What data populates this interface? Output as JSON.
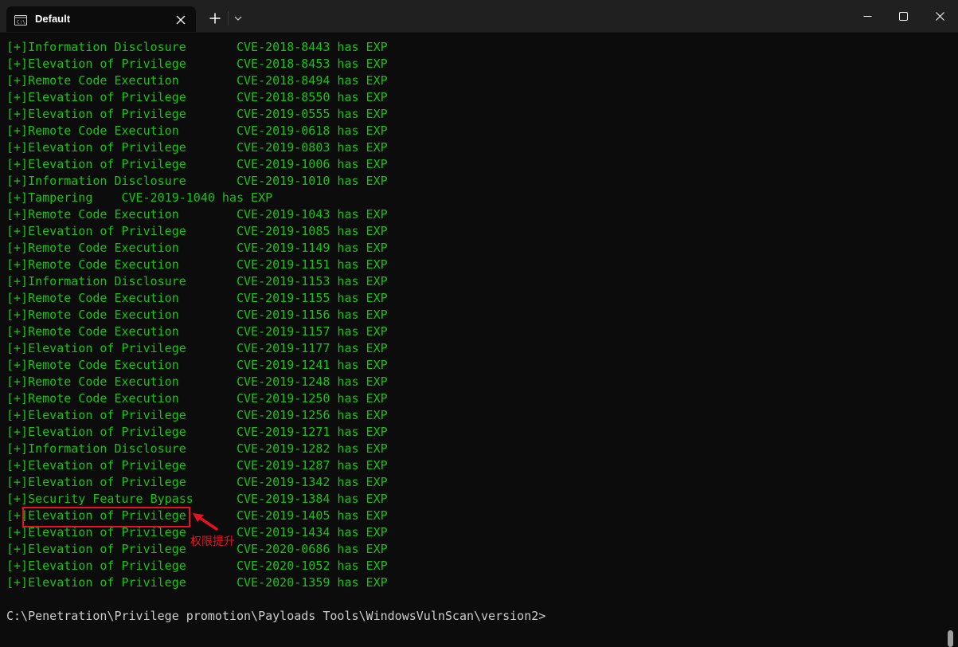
{
  "window": {
    "tab_title": "Default",
    "tab_icon": "terminal-icon",
    "close_tab_icon": "close-icon",
    "new_tab_icon": "plus-icon",
    "dropdown_icon": "chevron-down-icon",
    "minimize_icon": "minimize-icon",
    "maximize_icon": "maximize-icon",
    "close_window_icon": "close-icon"
  },
  "colors": {
    "output_green": "#16c60c",
    "prompt_gray": "#cccccc",
    "annotation_red": "#e81123",
    "terminal_bg": "#0c0c0c",
    "titlebar_bg": "#202020"
  },
  "terminal": {
    "lines": [
      "[+]Information Disclosure       CVE-2018-8443 has EXP",
      "[+]Elevation of Privilege       CVE-2018-8453 has EXP",
      "[+]Remote Code Execution        CVE-2018-8494 has EXP",
      "[+]Elevation of Privilege       CVE-2018-8550 has EXP",
      "[+]Elevation of Privilege       CVE-2019-0555 has EXP",
      "[+]Remote Code Execution        CVE-2019-0618 has EXP",
      "[+]Elevation of Privilege       CVE-2019-0803 has EXP",
      "[+]Elevation of Privilege       CVE-2019-1006 has EXP",
      "[+]Information Disclosure       CVE-2019-1010 has EXP",
      "[+]Tampering    CVE-2019-1040 has EXP",
      "[+]Remote Code Execution        CVE-2019-1043 has EXP",
      "[+]Elevation of Privilege       CVE-2019-1085 has EXP",
      "[+]Remote Code Execution        CVE-2019-1149 has EXP",
      "[+]Remote Code Execution        CVE-2019-1151 has EXP",
      "[+]Information Disclosure       CVE-2019-1153 has EXP",
      "[+]Remote Code Execution        CVE-2019-1155 has EXP",
      "[+]Remote Code Execution        CVE-2019-1156 has EXP",
      "[+]Remote Code Execution        CVE-2019-1157 has EXP",
      "[+]Elevation of Privilege       CVE-2019-1177 has EXP",
      "[+]Remote Code Execution        CVE-2019-1241 has EXP",
      "[+]Remote Code Execution        CVE-2019-1248 has EXP",
      "[+]Remote Code Execution        CVE-2019-1250 has EXP",
      "[+]Elevation of Privilege       CVE-2019-1256 has EXP",
      "[+]Elevation of Privilege       CVE-2019-1271 has EXP",
      "[+]Information Disclosure       CVE-2019-1282 has EXP",
      "[+]Elevation of Privilege       CVE-2019-1287 has EXP",
      "[+]Elevation of Privilege       CVE-2019-1342 has EXP",
      "[+]Security Feature Bypass      CVE-2019-1384 has EXP",
      "[+]Elevation of Privilege       CVE-2019-1405 has EXP",
      "[+]Elevation of Privilege       CVE-2019-1434 has EXP",
      "[+]Elevation of Privilege       CVE-2020-0686 has EXP",
      "[+]Elevation of Privilege       CVE-2020-1052 has EXP",
      "[+]Elevation of Privilege       CVE-2020-1359 has EXP"
    ],
    "prompt": "C:\\Penetration\\Privilege promotion\\Payloads Tools\\WindowsVulnScan\\version2>"
  },
  "annotation": {
    "label": "权限提升",
    "arrow_icon": "arrow-icon"
  }
}
